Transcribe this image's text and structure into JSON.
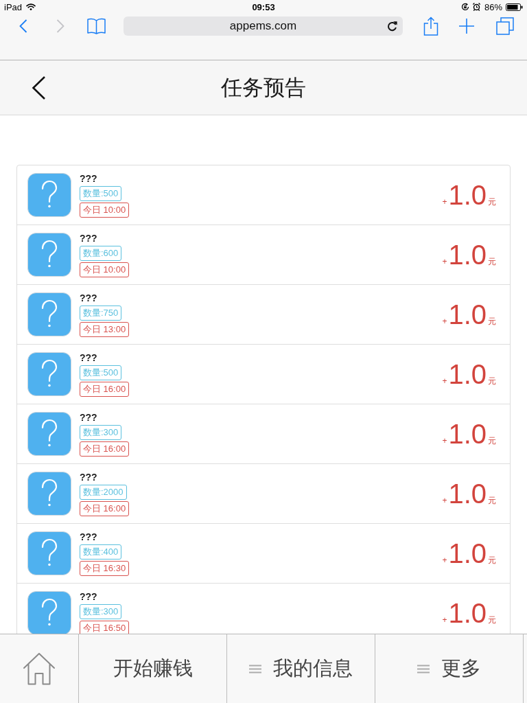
{
  "status_bar": {
    "device": "iPad",
    "time": "09:53",
    "battery": "86%"
  },
  "browser": {
    "back": {
      "disabled": false
    },
    "forward": {
      "disabled": true
    },
    "url": "appems.com"
  },
  "header": {
    "title": "任务预告"
  },
  "tasks": [
    {
      "name": "???",
      "quantity": "数量:500",
      "time": "今日 10:00",
      "sign": "+",
      "amount": "1.0",
      "unit": "元"
    },
    {
      "name": "???",
      "quantity": "数量:600",
      "time": "今日 10:00",
      "sign": "+",
      "amount": "1.0",
      "unit": "元"
    },
    {
      "name": "???",
      "quantity": "数量:750",
      "time": "今日 13:00",
      "sign": "+",
      "amount": "1.0",
      "unit": "元"
    },
    {
      "name": "???",
      "quantity": "数量:500",
      "time": "今日 16:00",
      "sign": "+",
      "amount": "1.0",
      "unit": "元"
    },
    {
      "name": "???",
      "quantity": "数量:300",
      "time": "今日 16:00",
      "sign": "+",
      "amount": "1.0",
      "unit": "元"
    },
    {
      "name": "???",
      "quantity": "数量:2000",
      "time": "今日 16:00",
      "sign": "+",
      "amount": "1.0",
      "unit": "元"
    },
    {
      "name": "???",
      "quantity": "数量:400",
      "time": "今日 16:30",
      "sign": "+",
      "amount": "1.0",
      "unit": "元"
    },
    {
      "name": "???",
      "quantity": "数量:300",
      "time": "今日 16:50",
      "sign": "+",
      "amount": "1.0",
      "unit": "元"
    }
  ],
  "tab_bar": [
    {
      "kind": "home"
    },
    {
      "kind": "plain",
      "label": "开始赚钱"
    },
    {
      "kind": "menu",
      "label": "我的信息"
    },
    {
      "kind": "menu",
      "label": "更多"
    }
  ]
}
